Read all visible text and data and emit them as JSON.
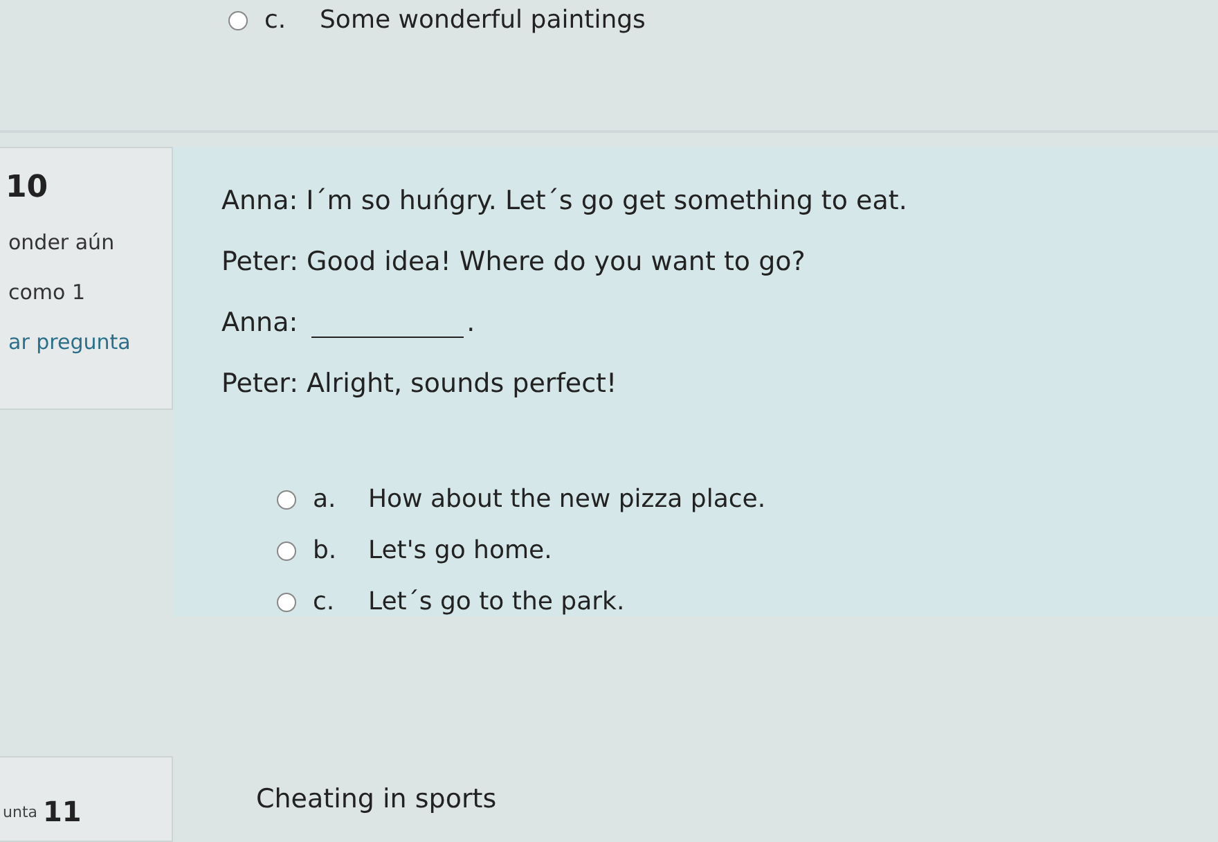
{
  "previous_question": {
    "options": [
      {
        "letter": "c.",
        "text": "Some wonderful paintings",
        "selected": false
      }
    ]
  },
  "questions": [
    {
      "info": {
        "number": "10",
        "status": "onder aún",
        "marks": "como 1",
        "flag_link": "ar pregunta"
      },
      "dialogue": [
        {
          "kind": "speech",
          "text": "Anna: I´m so huńgry. Let´s go get something to eat."
        },
        {
          "kind": "speech",
          "text": "Peter: Good idea! Where do you want to go?"
        },
        {
          "kind": "gap",
          "text": "Anna:",
          "suffix": "."
        },
        {
          "kind": "speech",
          "text": "Peter: Alright, sounds perfect!"
        }
      ],
      "options": [
        {
          "letter": "a.",
          "text": "How about the new pizza place.",
          "selected": false
        },
        {
          "letter": "b.",
          "text": "Let's go home.",
          "selected": false
        },
        {
          "letter": "c.",
          "text": "Let´s go to the park.",
          "selected": false
        }
      ]
    },
    {
      "info": {
        "label": "unta",
        "number": "11"
      },
      "text": "Cheating in sports"
    }
  ]
}
